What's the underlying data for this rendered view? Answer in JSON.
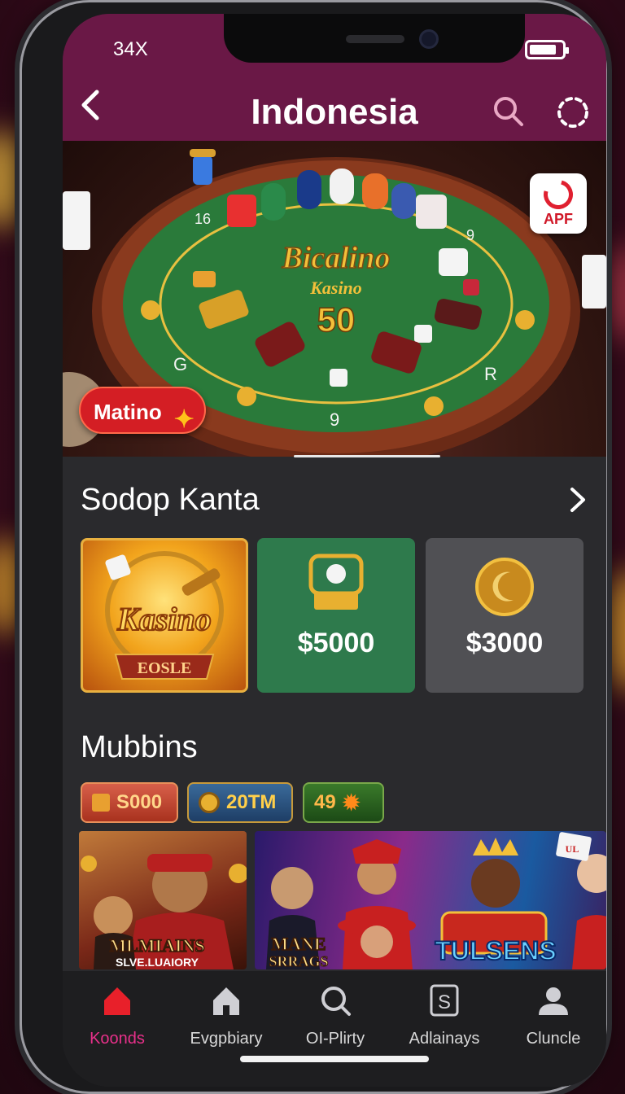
{
  "status": {
    "time": "34X"
  },
  "header": {
    "title": "Indonesia"
  },
  "hero": {
    "title": "Bicalino",
    "subtitle": "Kasino",
    "number": "50",
    "badge": "APF",
    "chip_label": "Matino"
  },
  "section1": {
    "title": "Sodop Kanta",
    "cards": [
      {
        "title": "Kasino",
        "ribbon": "EOSLE"
      },
      {
        "amount": "$5000"
      },
      {
        "amount": "$3000"
      }
    ]
  },
  "section2": {
    "title": "Mubbins",
    "pills": [
      {
        "label": "S000"
      },
      {
        "label": "20TM"
      },
      {
        "label": "49"
      }
    ],
    "promos": [
      {
        "title": "MLMIAINS",
        "subtitle": "SLVE.LUAIORY"
      },
      {
        "title": "MANE",
        "subtitle": "SRRAGS",
        "title2": "TULSENS",
        "sign": "UL"
      }
    ]
  },
  "nav": [
    {
      "label": "Koonds",
      "icon": "home-icon",
      "active": true
    },
    {
      "label": "Evgpbiary",
      "icon": "house-icon"
    },
    {
      "label": "OI-Plirty",
      "icon": "search-icon"
    },
    {
      "label": "Adlainays",
      "icon": "dollar-box-icon"
    },
    {
      "label": "Cluncle",
      "icon": "profile-icon"
    }
  ],
  "colors": {
    "header": "#6a1846",
    "accent": "#e8308a",
    "green_card": "#2e7a4c",
    "gray_card": "#505054",
    "felt": "#2a7a3a",
    "gold": "#f2c03a"
  }
}
